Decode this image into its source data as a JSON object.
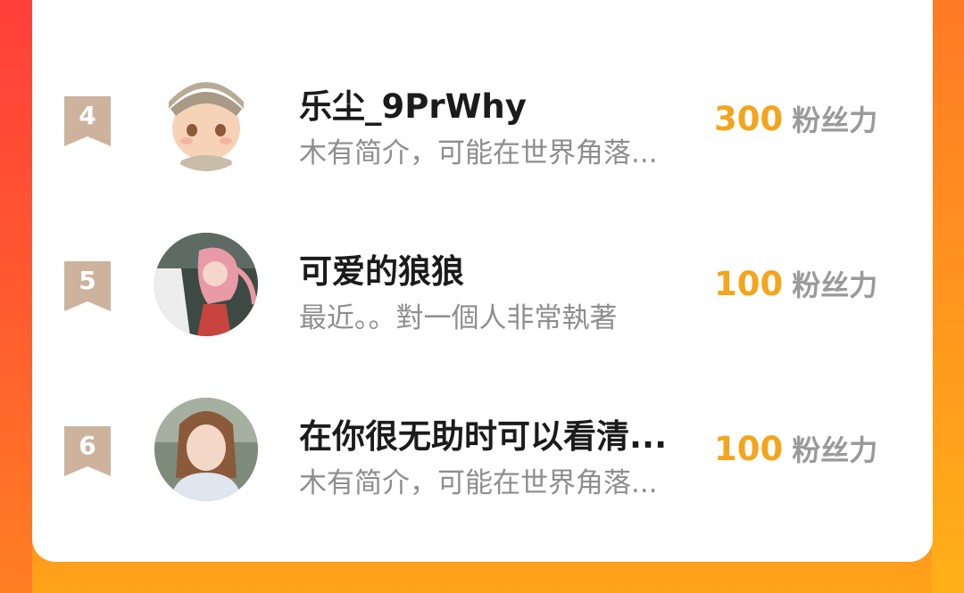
{
  "leaderboard": {
    "entries": [
      {
        "rank": "4",
        "name": "乐尘_9PrWhy",
        "bio": "木有简介，可能在世界角落...",
        "fans_value": "300",
        "fans_label": "粉丝力"
      },
      {
        "rank": "5",
        "name": "可爱的狼狼",
        "bio": "最近。。對一個人非常執著",
        "fans_value": "100",
        "fans_label": "粉丝力"
      },
      {
        "rank": "6",
        "name": "在你很无助时可以看清...",
        "bio": "木有简介，可能在世界角落...",
        "fans_value": "100",
        "fans_label": "粉丝力"
      }
    ]
  },
  "colors": {
    "badge": "#cdb39d",
    "fans_value": "#f3a51d",
    "fans_label": "#9a9a9a",
    "name": "#1b1b1b",
    "bio": "#8e8e8e",
    "background_top": "#ff5a2c",
    "background_bottom": "#ffa41a"
  }
}
